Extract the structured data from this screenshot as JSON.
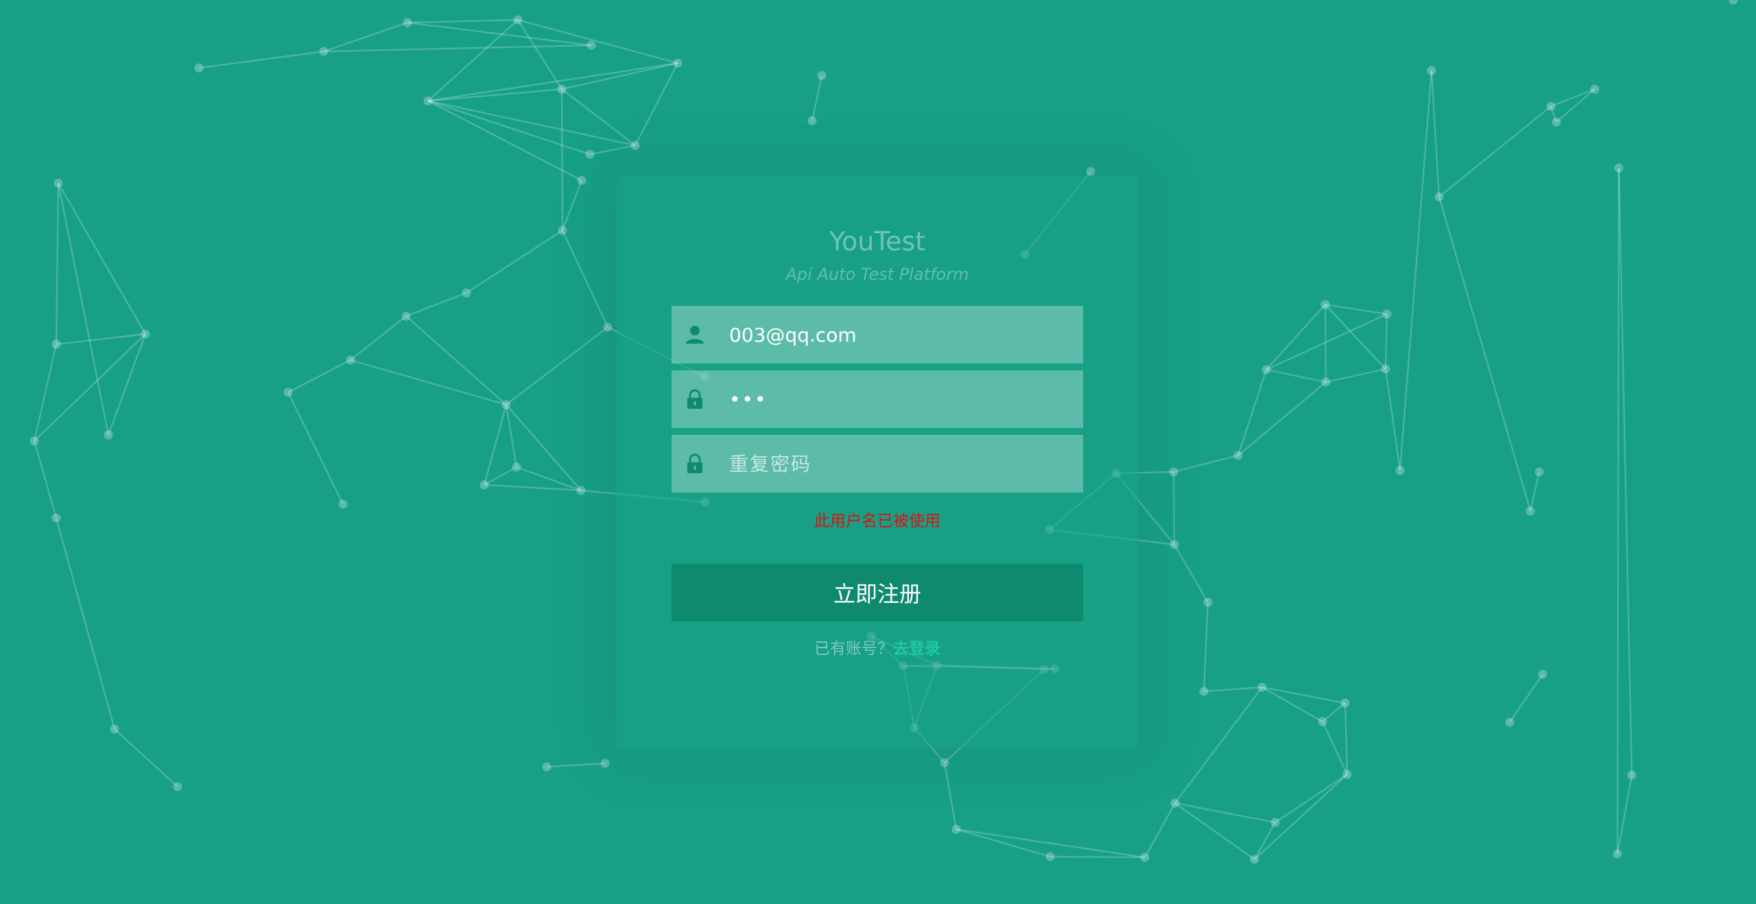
{
  "app": {
    "title": "YouTest",
    "subtitle": "Api Auto Test Platform"
  },
  "form": {
    "username": {
      "value": "003@qq.com",
      "icon": "user-icon"
    },
    "password": {
      "value": "123",
      "icon": "lock-icon"
    },
    "repeat_password": {
      "placeholder": "重复密码",
      "icon": "lock-icon"
    },
    "error_message": "此用户名已被使用",
    "submit_label": "立即注册"
  },
  "footer": {
    "prompt": "已有账号？",
    "login_link": "去登录"
  },
  "colors": {
    "background": "#17a085",
    "button": "#0e8b6f",
    "error": "#e01010",
    "link": "#1fc9a6"
  }
}
